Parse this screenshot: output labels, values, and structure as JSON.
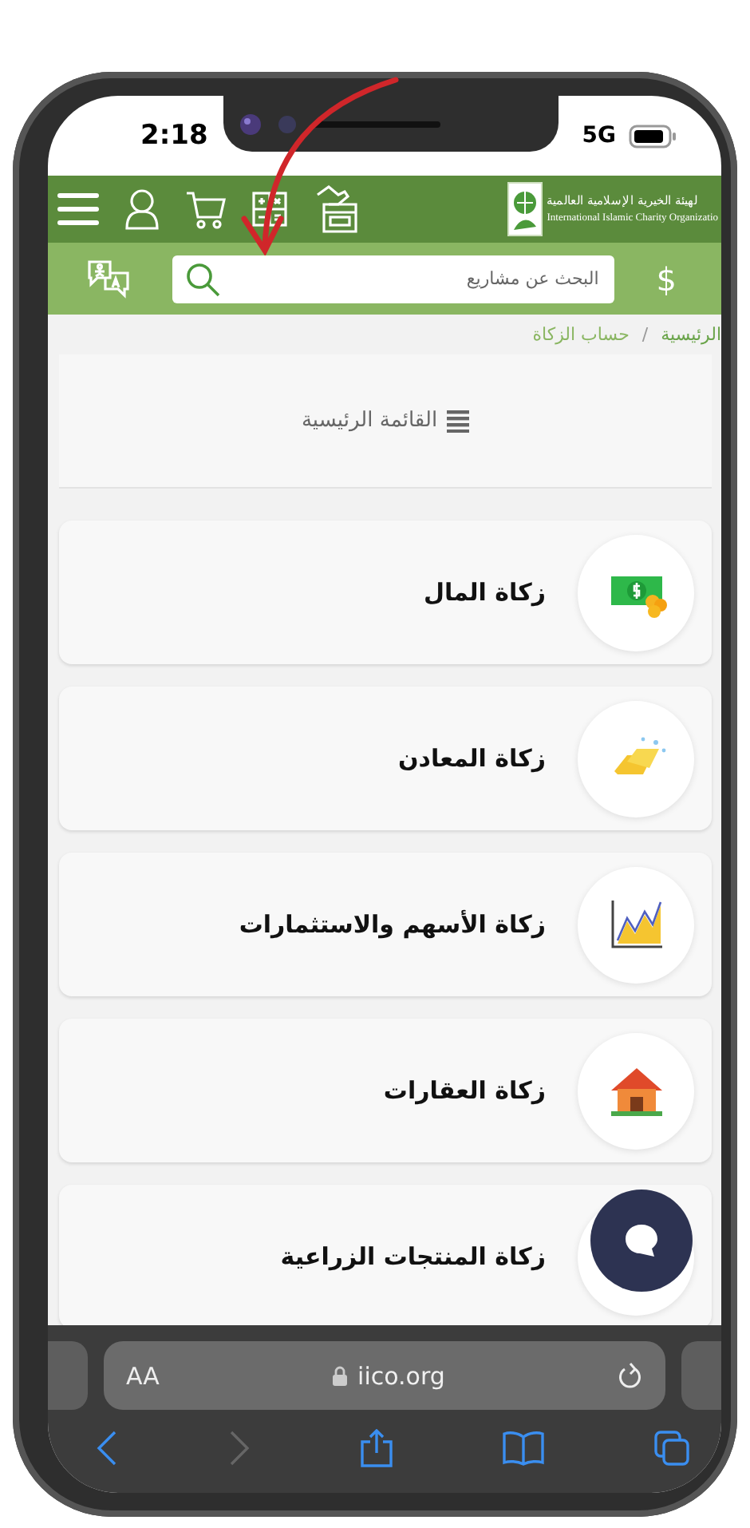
{
  "status_bar": {
    "time": "2:18",
    "network": "5G"
  },
  "header": {
    "logo": {
      "name_ar": "لهيئة الخيرية الإسلامية العالمية",
      "name_en": "International Islamic Charity Organizatio"
    }
  },
  "search": {
    "placeholder": "البحث عن مشاريع",
    "currency": "$"
  },
  "breadcrumb": {
    "separator": "/",
    "items": [
      {
        "label": "الرئيسية"
      },
      {
        "label": "حساب الزكاة"
      }
    ]
  },
  "main_menu": {
    "title": "القائمة الرئيسية"
  },
  "zakat_items": [
    {
      "label": "زكاة المال"
    },
    {
      "label": "زكاة المعادن"
    },
    {
      "label": "زكاة الأسهم والاستثمارات"
    },
    {
      "label": "زكاة العقارات"
    },
    {
      "label": "زكاة المنتجات الزراعية"
    }
  ],
  "browser": {
    "text_size": "AA",
    "url": "iico.org"
  }
}
